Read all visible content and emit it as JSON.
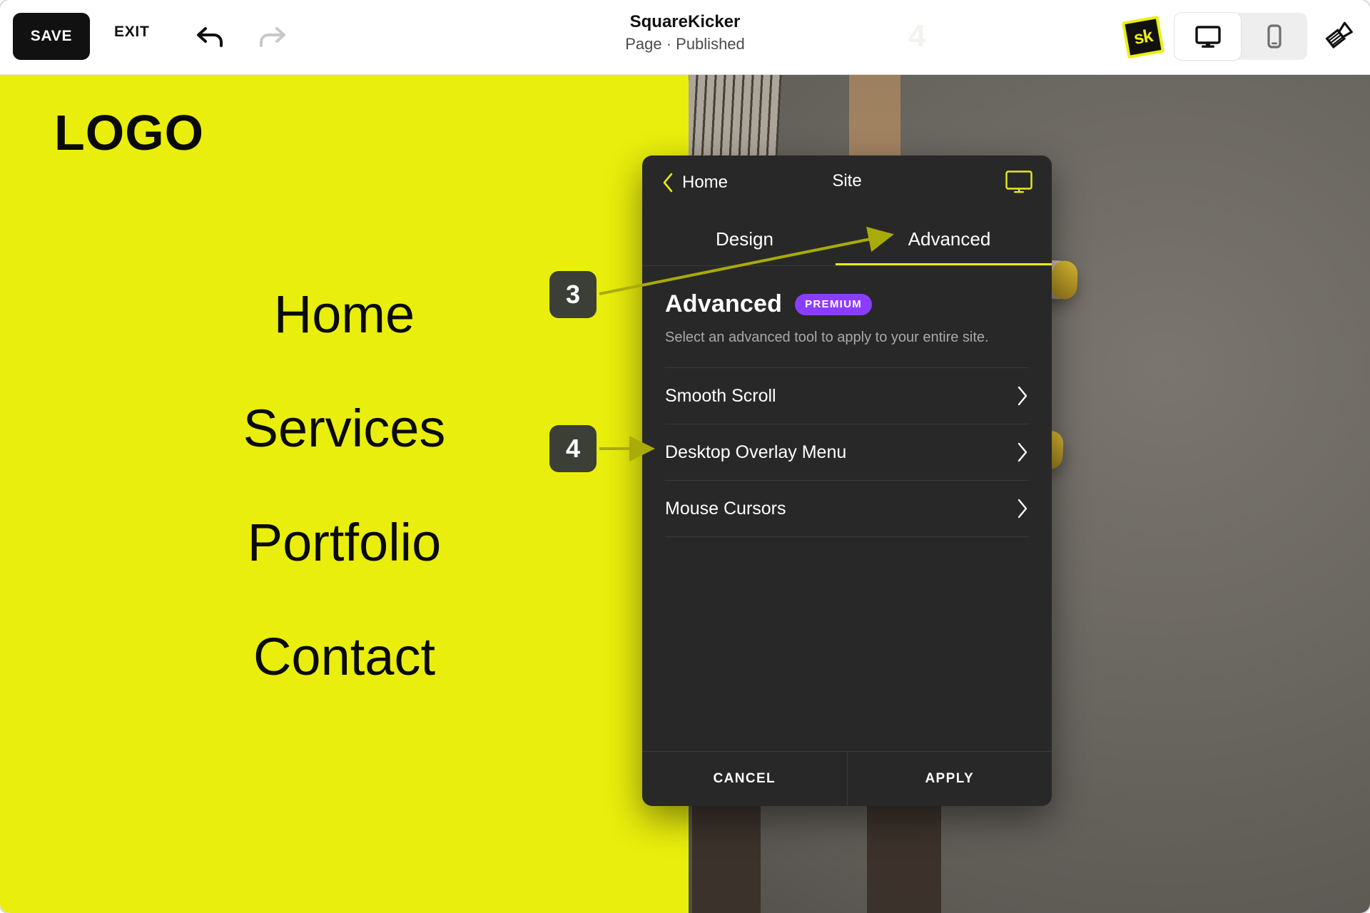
{
  "toolbar": {
    "save_label": "SAVE",
    "exit_label": "EXIT",
    "undo_icon": "undo-icon",
    "redo_icon": "redo-icon",
    "title": "SquareKicker",
    "subtitle": "Page · Published",
    "watermark_number": "4",
    "logo_text": "sk",
    "device_desktop_icon": "desktop-icon",
    "device_mobile_icon": "mobile-icon",
    "brush_icon": "paintbrush-icon",
    "active_device": "desktop"
  },
  "site_preview": {
    "logo": "LOGO",
    "nav_items": [
      "Home",
      "Services",
      "Portfolio",
      "Contact"
    ],
    "close_icon": "close-icon",
    "background_color": "#e9ee0c"
  },
  "panel": {
    "back_label": "Home",
    "back_icon": "chevron-left-icon",
    "title": "Site",
    "device_icon": "desktop-icon",
    "tabs": [
      {
        "label": "Design",
        "active": false
      },
      {
        "label": "Advanced",
        "active": true
      }
    ],
    "heading": "Advanced",
    "badge": "PREMIUM",
    "description": "Select an advanced tool to apply to your entire site.",
    "tools": [
      {
        "label": "Smooth Scroll",
        "chevron": "chevron-right-icon"
      },
      {
        "label": "Desktop Overlay Menu",
        "chevron": "chevron-right-icon"
      },
      {
        "label": "Mouse Cursors",
        "chevron": "chevron-right-icon"
      }
    ],
    "cancel_label": "CANCEL",
    "apply_label": "APPLY"
  },
  "callouts": [
    {
      "number": "3",
      "target": "Advanced tab"
    },
    {
      "number": "4",
      "target": "Desktop Overlay Menu row"
    }
  ],
  "colors": {
    "brand_yellow": "#e9ee0c",
    "accent_yellow": "#e7ea1a",
    "premium_purple": "#8b3dff",
    "panel_bg": "#282828",
    "callout_bg": "#3c3f35",
    "arrow_olive": "#a9ab08"
  }
}
